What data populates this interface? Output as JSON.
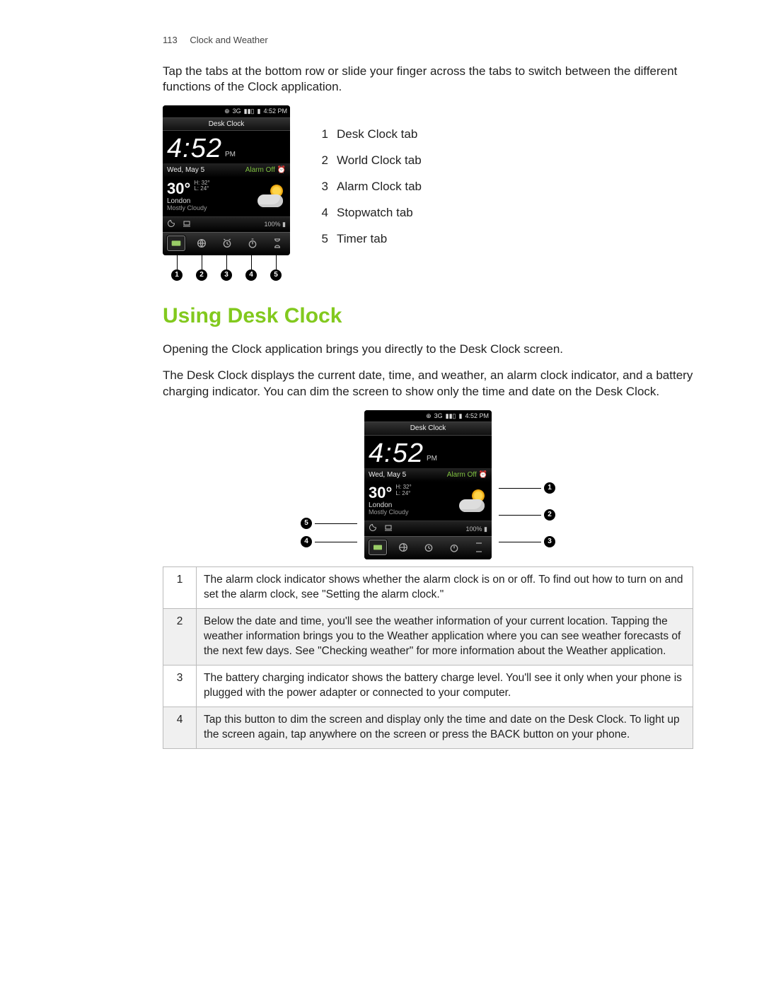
{
  "header": {
    "page_number": "113",
    "section": "Clock and Weather"
  },
  "intro": "Tap the tabs at the bottom row or slide your finger across the tabs to switch between the different functions of the Clock application.",
  "phone": {
    "status_time": "4:52 PM",
    "status_net": "3G",
    "title": "Desk Clock",
    "time": "4:52",
    "ampm": "PM",
    "date": "Wed, May 5",
    "alarm": "Alarm Off",
    "temp": "30°",
    "hi": "H: 32°",
    "lo": "L: 24°",
    "city": "London",
    "cond": "Mostly Cloudy",
    "battery": "100%"
  },
  "tab_legend": [
    {
      "n": "1",
      "label": "Desk Clock tab"
    },
    {
      "n": "2",
      "label": "World Clock tab"
    },
    {
      "n": "3",
      "label": "Alarm Clock tab"
    },
    {
      "n": "4",
      "label": "Stopwatch tab"
    },
    {
      "n": "5",
      "label": "Timer tab"
    }
  ],
  "section_heading": "Using Desk Clock",
  "para1": "Opening the Clock application brings you directly to the Desk Clock screen.",
  "para2": "The Desk Clock displays the current date, time, and weather, an alarm clock indicator, and a battery charging indicator. You can dim the screen to show only the time and date on the Desk Clock.",
  "callout_nums": {
    "a": "1",
    "b": "2",
    "c": "3",
    "d": "4",
    "e": "5"
  },
  "explanations": [
    {
      "n": "1",
      "text": "The alarm clock indicator shows whether the alarm clock is on or off. To find out how to turn on and set the alarm clock, see \"Setting the alarm clock.\""
    },
    {
      "n": "2",
      "text": "Below the date and time, you'll see the weather information of your current location. Tapping the weather information brings you to the Weather application where you can see weather forecasts of the next few days. See \"Checking weather\" for more information about the Weather application."
    },
    {
      "n": "3",
      "text": "The battery charging indicator shows the battery charge level. You'll see it only when your phone is plugged with the power adapter or connected to your computer."
    },
    {
      "n": "4",
      "text": "Tap this button to dim the screen and display only the time and date on the Desk Clock. To light up the screen again, tap anywhere on the screen or press the BACK button on your phone."
    }
  ]
}
